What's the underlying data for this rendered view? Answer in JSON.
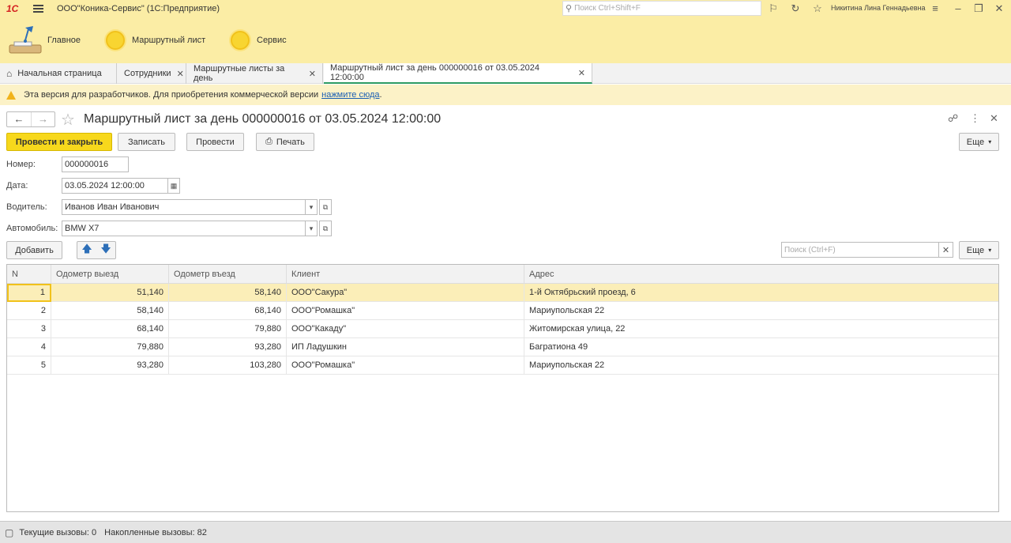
{
  "app": {
    "logo": "1С",
    "title": "ООО\"Коника-Сервис\"  (1С:Предприятие)",
    "search_placeholder": "Поиск Ctrl+Shift+F",
    "user": "Никитина Лина Геннадьевна"
  },
  "sections": [
    {
      "label": "Главное"
    },
    {
      "label": "Маршрутный лист"
    },
    {
      "label": "Сервис"
    }
  ],
  "tabs": [
    {
      "label": "Начальная страница"
    },
    {
      "label": "Сотрудники"
    },
    {
      "label": "Маршрутные листы за день"
    },
    {
      "label": "Маршрутный лист за день 000000016 от 03.05.2024 12:00:00"
    }
  ],
  "warning": {
    "text": "Эта версия для разработчиков. Для приобретения коммерческой версии",
    "link": "нажмите сюда",
    "tail": "."
  },
  "form": {
    "title": "Маршрутный лист за день 000000016 от 03.05.2024 12:00:00",
    "post_close": "Провести и закрыть",
    "save": "Записать",
    "post": "Провести",
    "print": "Печать",
    "more": "Еще",
    "fields": {
      "number_label": "Номер:",
      "number_value": "000000016",
      "date_label": "Дата:",
      "date_value": "03.05.2024 12:00:00",
      "driver_label": "Водитель:",
      "driver_value": "Иванов Иван Иванович",
      "car_label": "Автомобиль:",
      "car_value": "BMW X7"
    },
    "table_bar": {
      "add": "Добавить",
      "search_placeholder": "Поиск (Ctrl+F)",
      "more": "Еще"
    }
  },
  "table": {
    "columns": [
      "N",
      "Одометр выезд",
      "Одометр въезд",
      "Клиент",
      "Адрес"
    ],
    "rows": [
      [
        "1",
        "51,140",
        "58,140",
        "ООО\"Сакура\"",
        "1-й Октябрьский проезд, 6"
      ],
      [
        "2",
        "58,140",
        "68,140",
        "ООО\"Ромашка\"",
        "Мариупольская 22"
      ],
      [
        "3",
        "68,140",
        "79,880",
        "ООО\"Какаду\"",
        "Житомирская улица, 22"
      ],
      [
        "4",
        "79,880",
        "93,280",
        "ИП Ладушкин",
        "Багратиона 49"
      ],
      [
        "5",
        "93,280",
        "103,280",
        "ООО\"Ромашка\"",
        "Мариупольская 22"
      ]
    ]
  },
  "status": {
    "current": "Текущие вызовы: 0",
    "accumulated": "Накопленные вызовы: 82"
  },
  "colors": {
    "panel": "#fbeda5",
    "accent": "#f7d81c",
    "active_tab_underline": "#2e9b63",
    "selection": "#fbeeb8"
  }
}
